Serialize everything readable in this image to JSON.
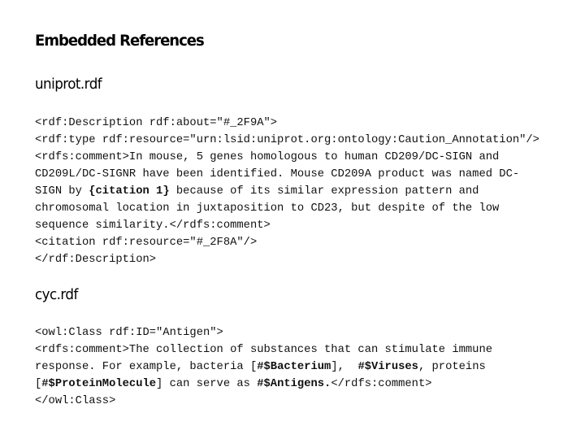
{
  "slide": {
    "title": "Embedded References"
  },
  "sections": [
    {
      "heading": "uniprot.rdf",
      "lines": [
        [
          {
            "t": "<rdf:Description rdf:about=\"#_2F9A\">"
          }
        ],
        [
          {
            "t": "<rdf:type rdf:resource=\"urn:lsid:uniprot.org:ontology:Caution_Annotation\"/>"
          }
        ],
        [
          {
            "t": "<rdfs:comment>In mouse, 5 genes homologous to human CD209/DC-SIGN and"
          }
        ],
        [
          {
            "t": "CD209L/DC-SIGNR have been identified. Mouse CD209A product was named DC-"
          }
        ],
        [
          {
            "t": "SIGN by "
          },
          {
            "t": "{citation 1}",
            "b": true
          },
          {
            "t": " because of its similar expression pattern and"
          }
        ],
        [
          {
            "t": "chromosomal location in juxtaposition to CD23, but despite of the low"
          }
        ],
        [
          {
            "t": "sequence similarity.</rdfs:comment>"
          }
        ],
        [
          {
            "t": "<citation rdf:resource=\"#_2F8A\"/>"
          }
        ],
        [
          {
            "t": "</rdf:Description>"
          }
        ]
      ]
    },
    {
      "heading": "cyc.rdf",
      "lines": [
        [
          {
            "t": "<owl:Class rdf:ID=\"Antigen\">"
          }
        ],
        [
          {
            "t": "<rdfs:comment>The collection of substances that can stimulate immune"
          }
        ],
        [
          {
            "t": "response. For example, bacteria ["
          },
          {
            "t": "#$Bacterium",
            "b": true
          },
          {
            "t": "],  "
          },
          {
            "t": "#$Viruses",
            "b": true
          },
          {
            "t": ", proteins"
          }
        ],
        [
          {
            "t": "["
          },
          {
            "t": "#$ProteinMolecule",
            "b": true
          },
          {
            "t": "] can serve as "
          },
          {
            "t": "#$Antigens.",
            "b": true
          },
          {
            "t": "</rdfs:comment>"
          }
        ],
        [
          {
            "t": "</owl:Class>"
          }
        ]
      ]
    }
  ]
}
